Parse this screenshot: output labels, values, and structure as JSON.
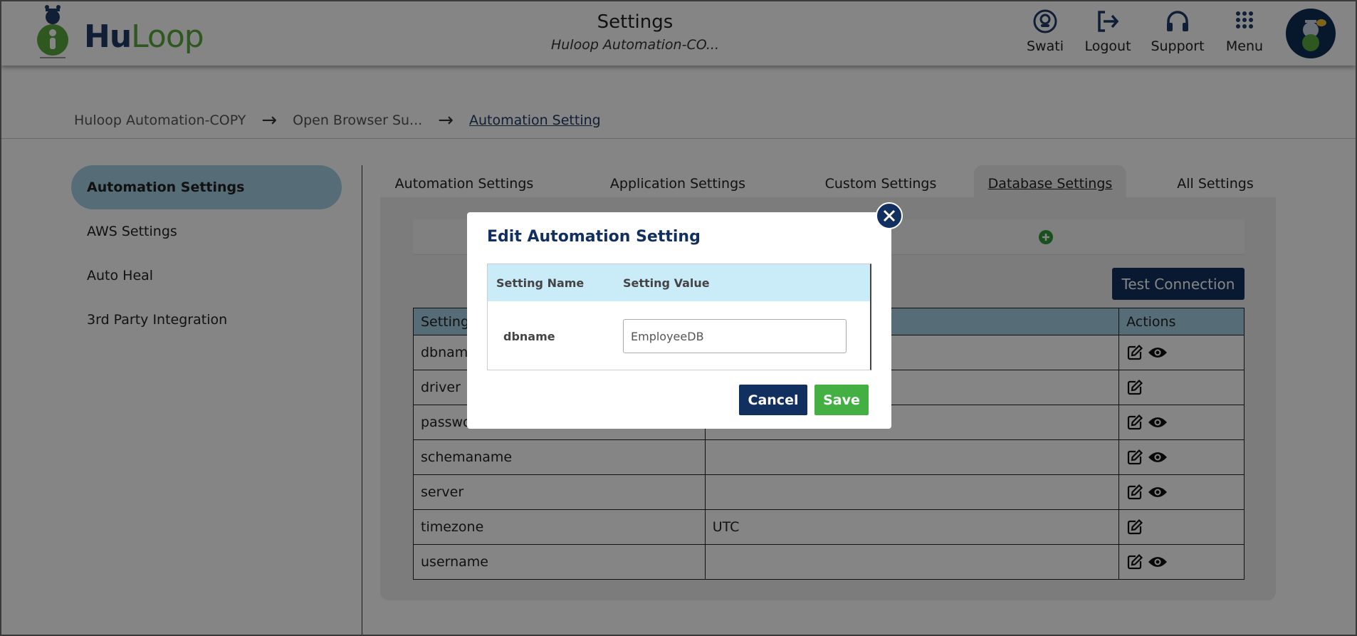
{
  "header": {
    "title": "Settings",
    "subtitle": "Huloop Automation-CO...",
    "logo_hu": "Hu",
    "logo_loop": "Loop",
    "nav": [
      {
        "label": "Swati",
        "icon": "user-icon"
      },
      {
        "label": "Logout",
        "icon": "logout-icon"
      },
      {
        "label": "Support",
        "icon": "headphones-icon"
      },
      {
        "label": "Menu",
        "icon": "grid-menu-icon"
      }
    ]
  },
  "breadcrumb": {
    "items": [
      "Huloop Automation-COPY",
      "Open Browser Su...",
      "Automation Setting"
    ]
  },
  "sidebar": {
    "items": [
      {
        "label": "Automation Settings",
        "active": true
      },
      {
        "label": "AWS Settings"
      },
      {
        "label": "Auto Heal"
      },
      {
        "label": "3rd Party Integration"
      }
    ]
  },
  "tabs": [
    {
      "label": "Automation Settings"
    },
    {
      "label": "Application Settings"
    },
    {
      "label": "Custom Settings"
    },
    {
      "label": "Database Settings",
      "active": true
    },
    {
      "label": "All Settings"
    }
  ],
  "panel": {
    "test_connection_label": "Test Connection",
    "table": {
      "headers": [
        "Setting",
        "",
        "Actions"
      ],
      "rows": [
        {
          "name": "dbname",
          "value": "",
          "view": true
        },
        {
          "name": "driver",
          "value": "",
          "view": false
        },
        {
          "name": "password",
          "value": "",
          "view": true
        },
        {
          "name": "schemaname",
          "value": "",
          "view": true
        },
        {
          "name": "server",
          "value": "",
          "view": true
        },
        {
          "name": "timezone",
          "value": "UTC",
          "view": false
        },
        {
          "name": "username",
          "value": "",
          "view": true
        }
      ]
    }
  },
  "modal": {
    "title": "Edit Automation Setting",
    "col_name": "Setting Name",
    "col_value": "Setting Value",
    "setting_name": "dbname",
    "setting_value": "EmployeeDB",
    "cancel_label": "Cancel",
    "save_label": "Save"
  },
  "colors": {
    "brand_navy": "#12305f",
    "brand_green": "#5aa93f",
    "save_green": "#44b044",
    "table_header_blue": "#a6cfe3"
  }
}
